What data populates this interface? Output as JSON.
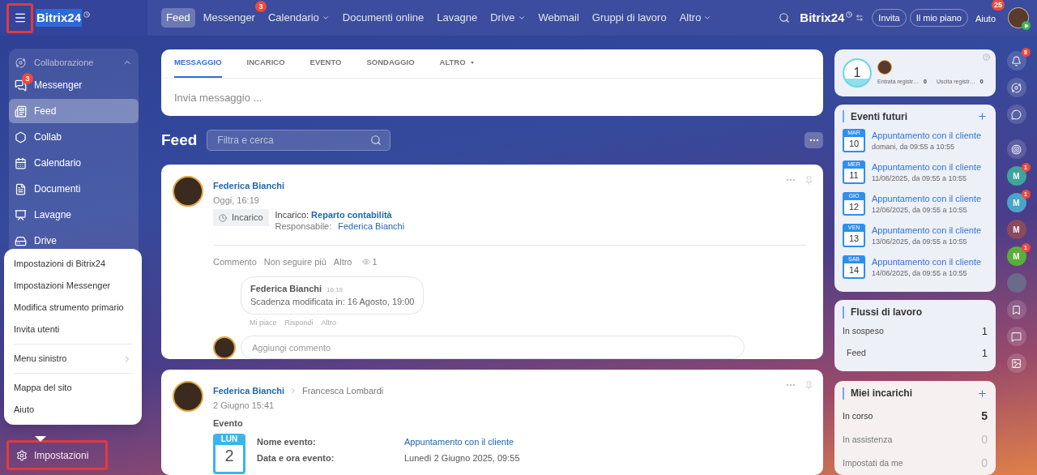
{
  "topbar": {
    "menu_button": {
      "highlighted": true
    },
    "logo": "Bitrix24",
    "nav": [
      {
        "label": "Feed",
        "selected": true,
        "dropdown": false
      },
      {
        "label": "Messenger",
        "selected": false,
        "dropdown": false,
        "badge": "3"
      },
      {
        "label": "Calendario",
        "selected": false,
        "dropdown": true
      },
      {
        "label": "Documenti online",
        "selected": false,
        "dropdown": false
      },
      {
        "label": "Lavagne",
        "selected": false,
        "dropdown": false
      },
      {
        "label": "Drive",
        "selected": false,
        "dropdown": true
      },
      {
        "label": "Webmail",
        "selected": false,
        "dropdown": false
      },
      {
        "label": "Gruppi di lavoro",
        "selected": false,
        "dropdown": false
      },
      {
        "label": "Altro",
        "selected": false,
        "dropdown": true
      }
    ],
    "brand": "Bitrix24",
    "buttons": [
      "Invita",
      "Il mio piano"
    ],
    "help": {
      "label": "Aiuto",
      "badge": "25"
    }
  },
  "sidebar": {
    "section": "Collaborazione",
    "expanded": true,
    "items": [
      {
        "label": "Messenger",
        "selected": false,
        "badge": "3"
      },
      {
        "label": "Feed",
        "selected": true
      },
      {
        "label": "Collab",
        "selected": false
      },
      {
        "label": "Calendario",
        "selected": false
      },
      {
        "label": "Documenti",
        "selected": false
      },
      {
        "label": "Lavagne",
        "selected": false
      },
      {
        "label": "Drive",
        "selected": false
      }
    ],
    "settings": {
      "label": "Impostazioni",
      "highlighted": true
    }
  },
  "settings_menu": {
    "groups": [
      [
        {
          "label": "Impostazioni di Bitrix24",
          "submenu": false
        },
        {
          "label": "Impostazioni Messenger",
          "submenu": false
        },
        {
          "label": "Modifica strumento primario",
          "submenu": false
        },
        {
          "label": "Invita utenti",
          "submenu": false
        }
      ],
      [
        {
          "label": "Menu sinistro",
          "submenu": true
        }
      ],
      [
        {
          "label": "Mappa del sito",
          "submenu": false
        },
        {
          "label": "Aiuto",
          "submenu": false
        }
      ]
    ]
  },
  "composer": {
    "tabs": [
      {
        "label": "MESSAGGIO",
        "selected": true,
        "dropdown": false
      },
      {
        "label": "INCARICO",
        "selected": false,
        "dropdown": false
      },
      {
        "label": "EVENTO",
        "selected": false,
        "dropdown": false
      },
      {
        "label": "SONDAGGIO",
        "selected": false,
        "dropdown": false
      },
      {
        "label": "ALTRO",
        "selected": false,
        "dropdown": true
      }
    ],
    "placeholder": "Invia messaggio ..."
  },
  "feed": {
    "title": "Feed",
    "search_placeholder": "Filtra e cerca",
    "task_post": {
      "author": "Federica Bianchi",
      "time": "Oggi, 16:19",
      "tag": "Incarico",
      "task_label": "Incarico:",
      "task_link": "Reparto contabilità",
      "responsible_label": "Responsabile:",
      "responsible": "Federica Bianchi",
      "actions": [
        "Commento",
        "Non seguire più",
        "Altro"
      ],
      "views": "1",
      "comment": {
        "author": "Federica Bianchi",
        "time": "16:19",
        "text": "Scadenza modificata in: 16 Agosto, 19:00",
        "actions": [
          "Mi piace",
          "Rispondi",
          "Altro"
        ]
      },
      "comment_placeholder": "Aggiungi commento"
    },
    "event_post": {
      "author": "Federica Bianchi",
      "recipient": "Francesca Lombardi",
      "time": "2 Giugno 15:41",
      "type": "Evento",
      "weekday": "LUN",
      "day": "2",
      "fields": [
        {
          "label": "Nome evento:",
          "value": "Appuntamento con il cliente",
          "link": true
        },
        {
          "label": "Data e ora evento:",
          "value": "Lunedì 2 Giugno 2025, 09:55",
          "link": false
        }
      ]
    }
  },
  "timeman": {
    "counter": "1",
    "items": [
      {
        "label": "Entrata registr…",
        "value": "0"
      },
      {
        "label": "Uscita registr…",
        "value": "0"
      }
    ]
  },
  "events": {
    "title": "Eventi futuri",
    "items": [
      {
        "weekday": "MAR",
        "day": "10",
        "title": "Appuntamento con il cliente",
        "time": "domani, da 09:55 a 10:55"
      },
      {
        "weekday": "MER",
        "day": "11",
        "title": "Appuntamento con il cliente",
        "time": "11/06/2025, da 09:55 a 10:55"
      },
      {
        "weekday": "GIO",
        "day": "12",
        "title": "Appuntamento con il cliente",
        "time": "12/06/2025, da 09:55 a 10:55"
      },
      {
        "weekday": "VEN",
        "day": "13",
        "title": "Appuntamento con il cliente",
        "time": "13/06/2025, da 09:55 a 10:55"
      },
      {
        "weekday": "SAB",
        "day": "14",
        "title": "Appuntamento con il cliente",
        "time": "14/06/2025, da 09:55 a 10:55"
      }
    ]
  },
  "workflows": {
    "title": "Flussi di lavoro",
    "rows": [
      {
        "label": "In sospeso",
        "value": "1",
        "children": [
          {
            "label": "Feed",
            "value": "1"
          }
        ]
      }
    ]
  },
  "tasks": {
    "title": "Miei incarichi",
    "rows": [
      {
        "label": "In corso",
        "value": "5",
        "active": true
      },
      {
        "label": "In assistenza",
        "value": "0",
        "active": false
      },
      {
        "label": "Impostati da me",
        "value": "0",
        "active": false
      }
    ]
  },
  "rail": [
    {
      "kind": "icon",
      "badge": "8"
    },
    {
      "kind": "icon"
    },
    {
      "kind": "icon"
    },
    {
      "kind": "icon"
    },
    {
      "kind": "avatar",
      "letter": "M",
      "color": "#3fa59c",
      "badge": "1"
    },
    {
      "kind": "avatar",
      "letter": "M",
      "color": "#4aa6c8",
      "badge": "1"
    },
    {
      "kind": "avatar",
      "letter": "M",
      "color": "#8a4a5e"
    },
    {
      "kind": "avatar",
      "letter": "M",
      "color": "#5aae3a",
      "badge": "1"
    },
    {
      "kind": "photo"
    },
    {
      "kind": "icon"
    },
    {
      "kind": "icon"
    },
    {
      "kind": "icon"
    }
  ]
}
